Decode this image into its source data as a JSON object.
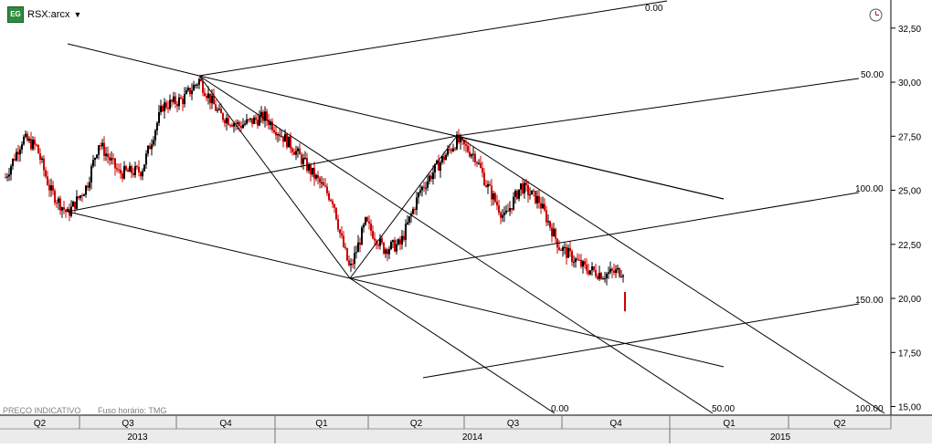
{
  "toolbar": {
    "symbol": "RSX:arcx",
    "logo_text": "EG"
  },
  "footer_note": {
    "price_note": "PREÇO INDICATIVO",
    "timezone_note": "Fuso horário: TMG"
  },
  "chart_data": {
    "type": "candlestick",
    "y_axis": {
      "ylim": [
        14.6,
        33.8
      ],
      "ticks": [
        "32,50",
        "30,00",
        "27,50",
        "25,00",
        "22,50",
        "20,00",
        "17,50",
        "15,00"
      ],
      "tick_values": [
        32.5,
        30.0,
        27.5,
        25.0,
        22.5,
        20.0,
        17.5,
        15.0
      ]
    },
    "x_axis": {
      "quarters": [
        "Q2",
        "Q3",
        "Q4",
        "Q1",
        "Q2",
        "Q3",
        "Q4",
        "Q1",
        "Q2"
      ],
      "years": [
        "2013",
        "2014",
        "2015"
      ]
    },
    "fib_labels": {
      "fan_top": [
        "0.00",
        "50.00",
        "100.00",
        "150.00"
      ],
      "fan_bottom": [
        "0.00",
        "50.00",
        "100.00"
      ]
    },
    "colors": {
      "up": "#000000",
      "down": "#cc0000",
      "lines": "#000000",
      "axis_band": "#ebebeb"
    }
  }
}
